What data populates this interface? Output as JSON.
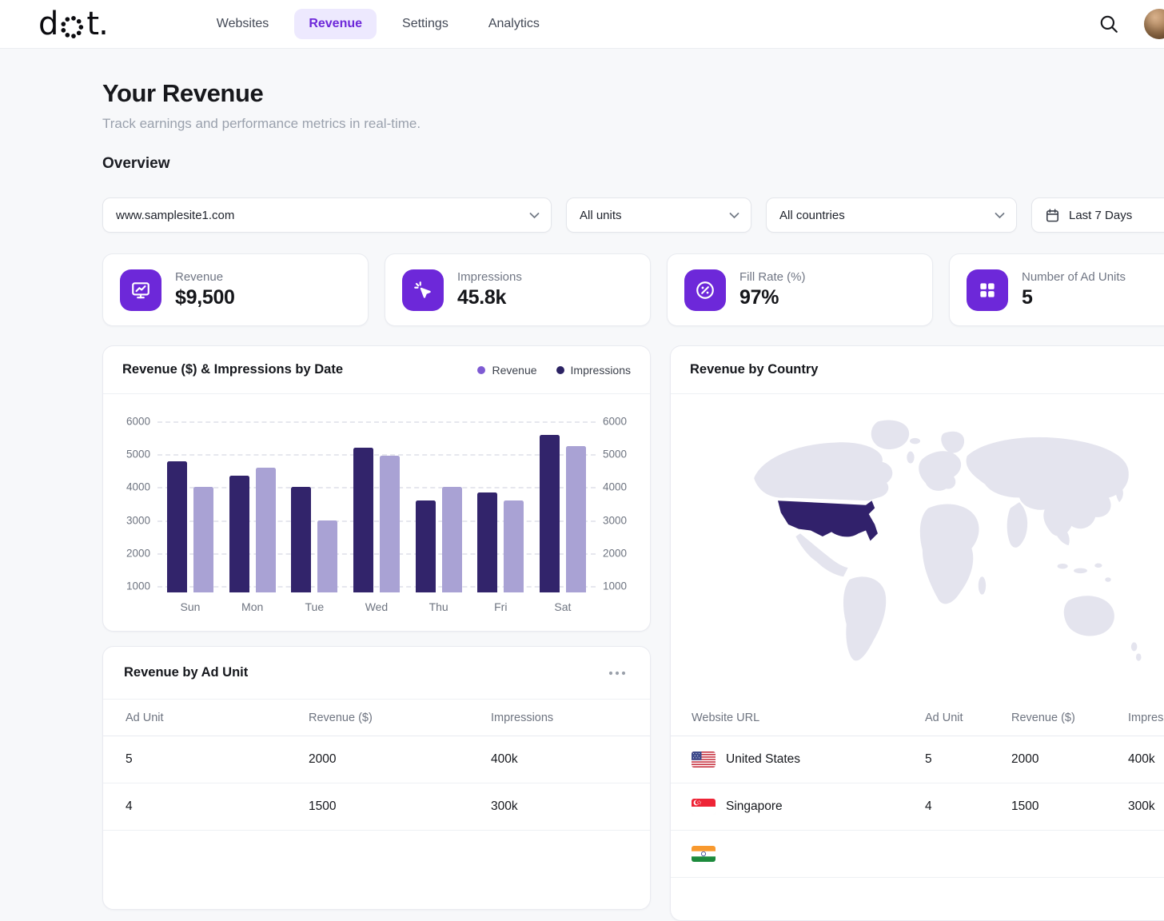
{
  "header": {
    "logo_text_d": "d",
    "logo_text_t": "t.",
    "nav": [
      {
        "label": "Websites",
        "active": false
      },
      {
        "label": "Revenue",
        "active": true
      },
      {
        "label": "Settings",
        "active": false
      },
      {
        "label": "Analytics",
        "active": false
      }
    ]
  },
  "page": {
    "title": "Your Revenue",
    "subtitle": "Track earnings and performance metrics in real-time.",
    "section_heading": "Overview"
  },
  "filters": {
    "website": "www.samplesite1.com",
    "units": "All units",
    "countries": "All countries",
    "date_range": "Last 7 Days"
  },
  "stats": [
    {
      "label": "Revenue",
      "value": "$9,500",
      "icon": "trend-chart-icon"
    },
    {
      "label": "Impressions",
      "value": "45.8k",
      "icon": "click-cursor-icon"
    },
    {
      "label": "Fill Rate (%)",
      "value": "97%",
      "icon": "percent-circle-icon"
    },
    {
      "label": "Number of Ad Units",
      "value": "5",
      "icon": "ad-units-grid-icon"
    }
  ],
  "chart_card": {
    "title": "Revenue ($) & Impressions by Date"
  },
  "chart_data": {
    "type": "bar",
    "title": "Revenue ($) & Impressions by Date",
    "categories": [
      "Sun",
      "Mon",
      "Tue",
      "Wed",
      "Thu",
      "Fri",
      "Sat"
    ],
    "series": [
      {
        "name": "Impressions",
        "color": "#32246b",
        "values": [
          4800,
          4350,
          4000,
          5200,
          3600,
          3850,
          5600
        ]
      },
      {
        "name": "Revenue",
        "color": "#a9a2d4",
        "values": [
          4000,
          4600,
          3000,
          4950,
          4000,
          3600,
          5250
        ]
      }
    ],
    "legend": [
      {
        "label": "Revenue",
        "color": "#7e5bd3"
      },
      {
        "label": "Impressions",
        "color": "#2b2263"
      }
    ],
    "ylim": [
      800,
      6200
    ],
    "yticks": [
      1000,
      2000,
      3000,
      4000,
      5000,
      6000
    ],
    "grid": true,
    "legend_position": "top-right"
  },
  "ad_unit_table": {
    "title": "Revenue by Ad Unit",
    "columns": [
      "Ad Unit",
      "Revenue ($)",
      "Impressions"
    ],
    "rows": [
      [
        "5",
        "2000",
        "400k"
      ],
      [
        "4",
        "1500",
        "300k"
      ]
    ]
  },
  "country_card": {
    "title": "Revenue by Country",
    "columns": [
      "Website URL",
      "Ad Unit",
      "Revenue ($)",
      "Impressions"
    ],
    "rows": [
      {
        "country": "United States",
        "flag": "us",
        "ad_unit": "5",
        "revenue": "2000",
        "impressions": "400k"
      },
      {
        "country": "Singapore",
        "flag": "sg",
        "ad_unit": "4",
        "revenue": "1500",
        "impressions": "300k"
      },
      {
        "country": "",
        "flag": "in",
        "ad_unit": "",
        "revenue": "",
        "impressions": ""
      }
    ]
  },
  "colors": {
    "accent": "#6d28d9",
    "accent_bg": "#ede9fe",
    "map_land": "#e4e4ee",
    "map_highlight": "#31216b"
  }
}
